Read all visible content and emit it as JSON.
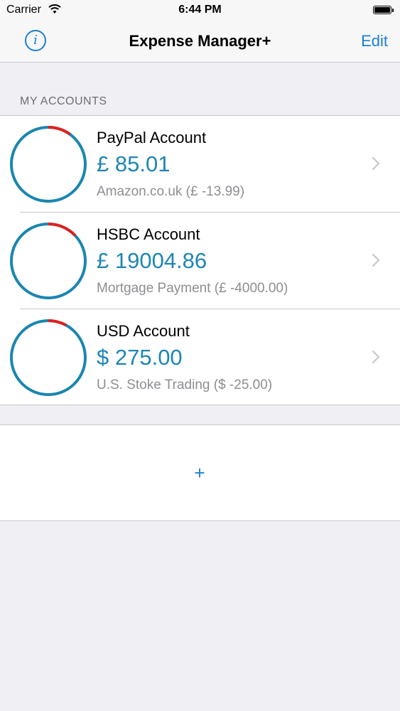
{
  "status_bar": {
    "carrier": "Carrier",
    "time": "6:44 PM"
  },
  "nav": {
    "title": "Expense Manager+",
    "edit_label": "Edit",
    "info_icon": "i"
  },
  "section": {
    "header": "MY ACCOUNTS"
  },
  "accounts": [
    {
      "name": "PayPal Account",
      "balance": "£ 85.01",
      "last_transaction": "Amazon.co.uk (£ -13.99)",
      "spent_fraction": 0.1
    },
    {
      "name": "HSBC Account",
      "balance": "£ 19004.86",
      "last_transaction": "Mortgage Payment (£ -4000.00)",
      "spent_fraction": 0.13
    },
    {
      "name": "USD Account",
      "balance": "$ 275.00",
      "last_transaction": "U.S. Stoke Trading ($ -25.00)",
      "spent_fraction": 0.08
    }
  ],
  "add": {
    "label": "+"
  },
  "colors": {
    "accent": "#1a80d9",
    "balance": "#1d86b4",
    "ring": "#1a86b0",
    "ring_spent": "#e02020"
  }
}
